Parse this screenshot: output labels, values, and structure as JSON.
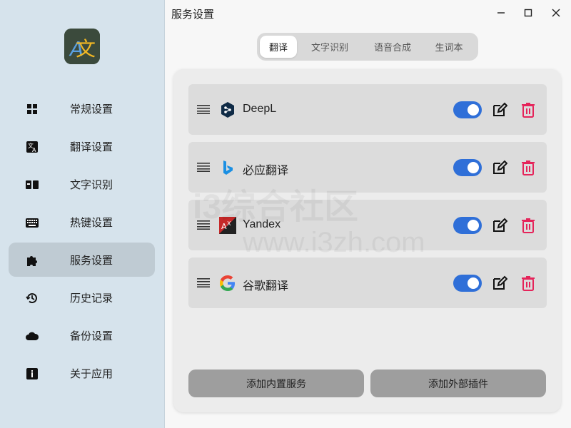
{
  "window": {
    "title": "服务设置",
    "controls": [
      "minimize",
      "maximize",
      "close"
    ]
  },
  "sidebar": {
    "logo_text": "文",
    "items": [
      {
        "label": "常规设置",
        "icon": "grid-icon",
        "active": false
      },
      {
        "label": "翻译设置",
        "icon": "translate-icon",
        "active": false
      },
      {
        "label": "文字识别",
        "icon": "ocr-icon",
        "active": false
      },
      {
        "label": "热键设置",
        "icon": "keyboard-icon",
        "active": false
      },
      {
        "label": "服务设置",
        "icon": "puzzle-icon",
        "active": true
      },
      {
        "label": "历史记录",
        "icon": "history-icon",
        "active": false
      },
      {
        "label": "备份设置",
        "icon": "cloud-icon",
        "active": false
      },
      {
        "label": "关于应用",
        "icon": "info-icon",
        "active": false
      }
    ]
  },
  "tabs": [
    {
      "label": "翻译",
      "active": true
    },
    {
      "label": "文字识别",
      "active": false
    },
    {
      "label": "语音合成",
      "active": false
    },
    {
      "label": "生词本",
      "active": false
    }
  ],
  "services": [
    {
      "name": "DeepL",
      "icon": "deepl-icon",
      "enabled": true
    },
    {
      "name": "必应翻译",
      "icon": "bing-icon",
      "enabled": true
    },
    {
      "name": "Yandex",
      "icon": "yandex-icon",
      "enabled": true
    },
    {
      "name": "谷歌翻译",
      "icon": "google-icon",
      "enabled": true
    }
  ],
  "actions": {
    "add_builtin": "添加内置服务",
    "add_plugin": "添加外部插件"
  },
  "watermark": {
    "text": "i3综合社区",
    "url": "www.i3zh.com"
  },
  "colors": {
    "accent": "#2f6fd8",
    "delete": "#e5245a",
    "sidebar_bg": "#d6e3ec"
  }
}
